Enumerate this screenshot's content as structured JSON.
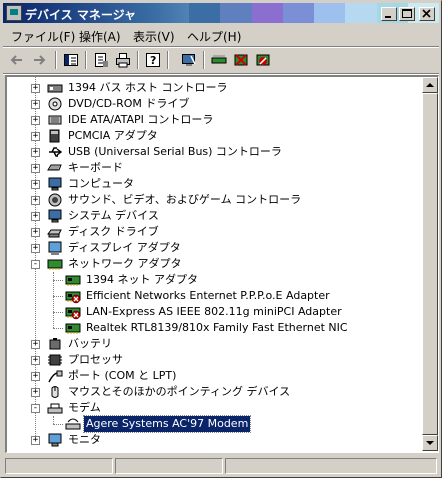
{
  "window": {
    "title": "デバイス マネージャ",
    "title_stripe_colors": [
      "#3a6ea5",
      "#5f7fbf",
      "#8a6fd0",
      "#7b8fd6",
      "#9ec0ee",
      "#b6d8f0",
      "#a4d8e4",
      "#cdeaf0"
    ]
  },
  "menu": [
    {
      "label": "ファイル(F)"
    },
    {
      "label": "操作(A)"
    },
    {
      "label": "表示(V)"
    },
    {
      "label": "ヘルプ(H)"
    }
  ],
  "toolbar": [
    {
      "icon": "back-arrow-icon"
    },
    {
      "icon": "forward-arrow-icon"
    },
    {
      "icon": "show-hide-tree-icon"
    },
    {
      "icon": "properties-icon"
    },
    {
      "icon": "print-icon"
    },
    {
      "icon": "help-icon"
    },
    {
      "icon": "scan-hardware-icon"
    },
    {
      "icon": "update-driver-icon"
    },
    {
      "icon": "uninstall-icon"
    },
    {
      "icon": "disable-icon"
    }
  ],
  "tree": [
    {
      "label": "1394 バス ホスト コントローラ",
      "level": 1,
      "expander": "+",
      "icon": "bus-controller-icon"
    },
    {
      "label": "DVD/CD-ROM ドライブ",
      "level": 1,
      "expander": "+",
      "icon": "cdrom-icon"
    },
    {
      "label": "IDE ATA/ATAPI コントローラ",
      "level": 1,
      "expander": "+",
      "icon": "ide-controller-icon"
    },
    {
      "label": "PCMCIA アダプタ",
      "level": 1,
      "expander": "+",
      "icon": "pcmcia-icon"
    },
    {
      "label": "USB (Universal Serial Bus) コントローラ",
      "level": 1,
      "expander": "+",
      "icon": "usb-icon"
    },
    {
      "label": "キーボード",
      "level": 1,
      "expander": "+",
      "icon": "keyboard-icon"
    },
    {
      "label": "コンピュータ",
      "level": 1,
      "expander": "+",
      "icon": "computer-icon"
    },
    {
      "label": "サウンド、ビデオ、およびゲーム コントローラ",
      "level": 1,
      "expander": "+",
      "icon": "sound-icon"
    },
    {
      "label": "システム デバイス",
      "level": 1,
      "expander": "+",
      "icon": "system-device-icon"
    },
    {
      "label": "ディスク ドライブ",
      "level": 1,
      "expander": "+",
      "icon": "disk-drive-icon"
    },
    {
      "label": "ディスプレイ アダプタ",
      "level": 1,
      "expander": "+",
      "icon": "display-adapter-icon"
    },
    {
      "label": "ネットワーク アダプタ",
      "level": 1,
      "expander": "-",
      "icon": "network-adapter-icon"
    },
    {
      "label": "1394 ネット アダプタ",
      "level": 2,
      "icon": "network-card-icon",
      "color": "#2e8b2e"
    },
    {
      "label": "Efficient Networks Enternet P.P.P.o.E Adapter",
      "level": 2,
      "icon": "network-card-icon",
      "color": "#2e8b2e",
      "status": "disabled"
    },
    {
      "label": "LAN-Express AS IEEE 802.11g miniPCI Adapter",
      "level": 2,
      "icon": "network-card-icon",
      "color": "#2e8b2e",
      "status": "disabled"
    },
    {
      "label": "Realtek RTL8139/810x Family Fast Ethernet NIC",
      "level": 2,
      "icon": "network-card-icon",
      "color": "#2e8b2e"
    },
    {
      "label": "バッテリ",
      "level": 1,
      "expander": "+",
      "icon": "battery-icon"
    },
    {
      "label": "プロセッサ",
      "level": 1,
      "expander": "+",
      "icon": "processor-icon"
    },
    {
      "label": "ポート (COM と LPT)",
      "level": 1,
      "expander": "+",
      "icon": "port-icon"
    },
    {
      "label": "マウスとそのほかのポインティング デバイス",
      "level": 1,
      "expander": "+",
      "icon": "mouse-icon"
    },
    {
      "label": "モデム",
      "level": 1,
      "expander": "-",
      "icon": "modem-icon"
    },
    {
      "label": "Agere Systems AC'97 Modem",
      "level": 2,
      "icon": "modem-device-icon",
      "selected": true
    },
    {
      "label": "モニタ",
      "level": 1,
      "expander": "+",
      "icon": "monitor-icon"
    }
  ],
  "colors": {
    "selection": "#0a246a",
    "disabled_mark": "#cc0000",
    "window_face": "#d4d0c8"
  }
}
